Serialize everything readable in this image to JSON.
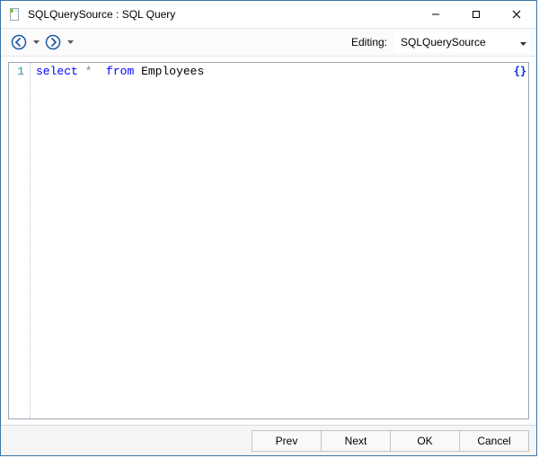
{
  "window": {
    "title": "SQLQuerySource : SQL Query"
  },
  "toolbar": {
    "editing_label": "Editing:",
    "editing_value": "SQLQuerySource"
  },
  "editor": {
    "line_numbers": [
      "1"
    ],
    "code_tokens": [
      [
        {
          "text": "select",
          "cls": "kw"
        },
        {
          "text": " ",
          "cls": "plain"
        },
        {
          "text": "*",
          "cls": "sym"
        },
        {
          "text": "  ",
          "cls": "plain"
        },
        {
          "text": "from",
          "cls": "kw"
        },
        {
          "text": " Employees",
          "cls": "plain"
        }
      ]
    ],
    "brace_badge": "{}"
  },
  "buttons": {
    "prev": "Prev",
    "next": "Next",
    "ok": "OK",
    "cancel": "Cancel"
  }
}
